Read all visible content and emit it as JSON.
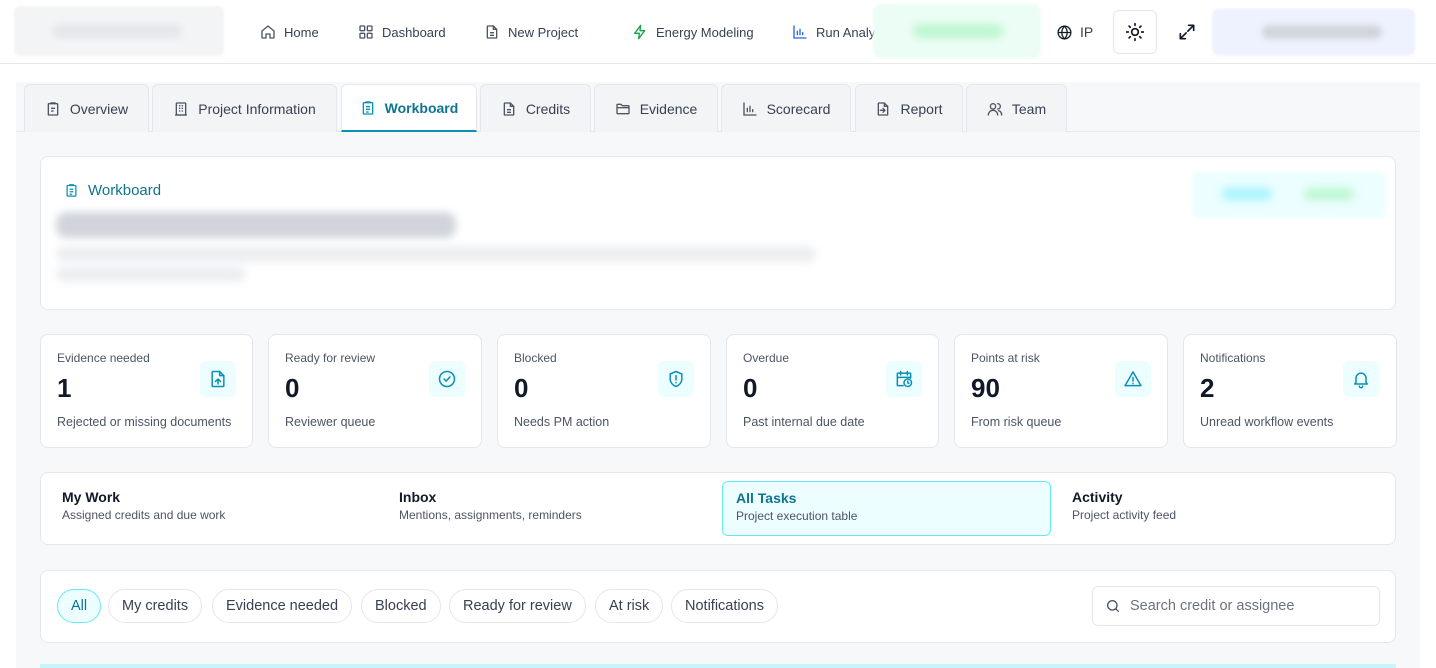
{
  "nav": {
    "items": [
      {
        "label": "Home",
        "icon": "home-icon"
      },
      {
        "label": "Dashboard",
        "icon": "dashboard-icon"
      },
      {
        "label": "New Project",
        "icon": "file-icon"
      },
      {
        "label": "Energy Modeling",
        "icon": "zap-icon"
      },
      {
        "label": "Run Analy",
        "icon": "bar-chart-icon"
      }
    ],
    "language": "IP"
  },
  "tabs": [
    {
      "label": "Overview"
    },
    {
      "label": "Project Information"
    },
    {
      "label": "Workboard",
      "active": true
    },
    {
      "label": "Credits"
    },
    {
      "label": "Evidence"
    },
    {
      "label": "Scorecard"
    },
    {
      "label": "Report"
    },
    {
      "label": "Team"
    }
  ],
  "workboard": {
    "title": "Workboard"
  },
  "stats": [
    {
      "label": "Evidence needed",
      "value": "1",
      "sub": "Rejected or missing documents",
      "icon": "file-upload-icon"
    },
    {
      "label": "Ready for review",
      "value": "0",
      "sub": "Reviewer queue",
      "icon": "check-circle-icon"
    },
    {
      "label": "Blocked",
      "value": "0",
      "sub": "Needs PM action",
      "icon": "shield-icon"
    },
    {
      "label": "Overdue",
      "value": "0",
      "sub": "Past internal due date",
      "icon": "calendar-clock-icon"
    },
    {
      "label": "Points at risk",
      "value": "90",
      "sub": "From risk queue",
      "icon": "warning-icon"
    },
    {
      "label": "Notifications",
      "value": "2",
      "sub": "Unread workflow events",
      "icon": "bell-icon"
    }
  ],
  "views": [
    {
      "title": "My Work",
      "sub": "Assigned credits and due work"
    },
    {
      "title": "Inbox",
      "sub": "Mentions, assignments, reminders"
    },
    {
      "title": "All Tasks",
      "sub": "Project execution table",
      "active": true
    },
    {
      "title": "Activity",
      "sub": "Project activity feed"
    }
  ],
  "filters": [
    {
      "label": "All",
      "active": true
    },
    {
      "label": "My credits"
    },
    {
      "label": "Evidence needed"
    },
    {
      "label": "Blocked"
    },
    {
      "label": "Ready for review"
    },
    {
      "label": "At risk"
    },
    {
      "label": "Notifications"
    }
  ],
  "search": {
    "placeholder": "Search credit or assignee"
  },
  "colors": {
    "accent": "#0891b2",
    "accent_dark": "#0e7490",
    "accent_light": "#ecfeff"
  }
}
